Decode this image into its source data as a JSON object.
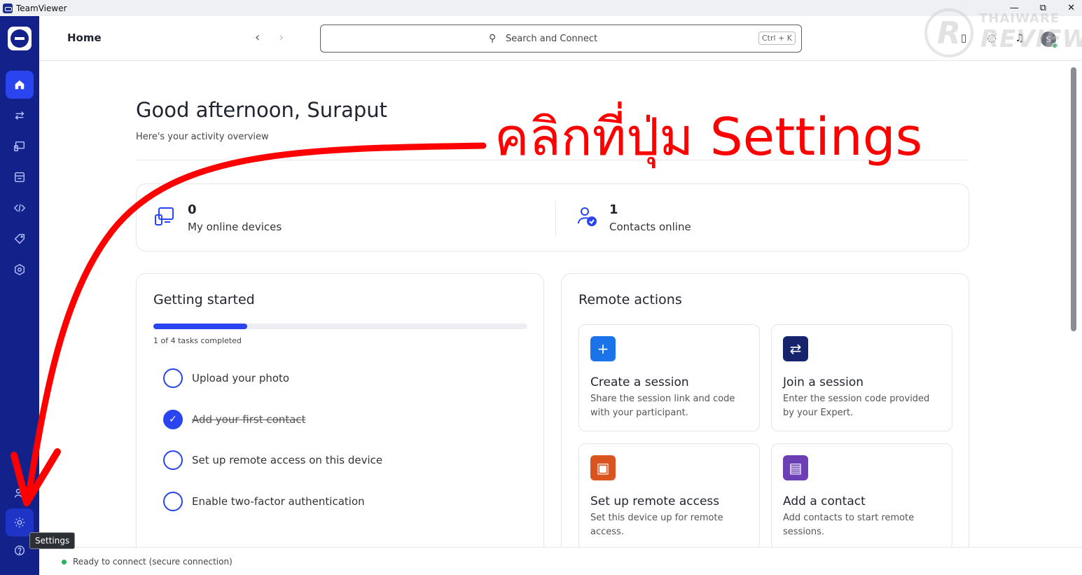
{
  "window": {
    "title": "TeamViewer",
    "controls": {
      "minimize": "—",
      "restore": "⧉",
      "close": "✕"
    }
  },
  "header": {
    "breadcrumb": "Home",
    "search_placeholder": "Search and Connect",
    "search_shortcut": "Ctrl + K",
    "avatar_initial": "S"
  },
  "sidebar": {
    "items": [
      {
        "name": "home-icon",
        "active": true
      },
      {
        "name": "connect-arrows-icon",
        "active": false
      },
      {
        "name": "devices-icon",
        "active": false
      },
      {
        "name": "sessions-icon",
        "active": false
      },
      {
        "name": "code-icon",
        "active": false
      },
      {
        "name": "tag-icon",
        "active": false
      },
      {
        "name": "hexagon-settings-icon",
        "active": false
      },
      {
        "name": "people-icon",
        "active": false
      },
      {
        "name": "gear-icon",
        "active": false
      },
      {
        "name": "help-icon",
        "active": false
      }
    ],
    "tooltip": "Settings"
  },
  "main": {
    "greeting": "Good afternoon, Suraput",
    "subtitle": "Here's your activity overview",
    "stats": [
      {
        "value": "0",
        "label": "My online devices",
        "icon": "devices-icon"
      },
      {
        "value": "1",
        "label": "Contacts online",
        "icon": "contact-check-icon"
      }
    ],
    "getting_started": {
      "title": "Getting started",
      "progress_fraction": 0.25,
      "progress_text": "1 of 4 tasks completed",
      "tasks": [
        {
          "label": "Upload your photo",
          "done": false
        },
        {
          "label": "Add your first contact",
          "done": true
        },
        {
          "label": "Set up remote access on this device",
          "done": false
        },
        {
          "label": "Enable two-factor authentication",
          "done": false
        }
      ]
    },
    "remote_actions": {
      "title": "Remote actions",
      "items": [
        {
          "title": "Create a session",
          "desc": "Share the session link and code with your participant.",
          "icon": "plus-icon",
          "color": "#1a73e8",
          "glyph": "+"
        },
        {
          "title": "Join a session",
          "desc": "Enter the session code provided by your Expert.",
          "icon": "swap-arrows-icon",
          "color": "#16246e",
          "glyph": "⇄"
        },
        {
          "title": "Set up remote access",
          "desc": "Set this device up for remote access.",
          "icon": "monitor-access-icon",
          "color": "#d9541e",
          "glyph": "▣"
        },
        {
          "title": "Add a contact",
          "desc": "Add contacts to start remote sessions.",
          "icon": "contact-book-icon",
          "color": "#6d3fb5",
          "glyph": "▤"
        }
      ]
    }
  },
  "status_bar": {
    "text": "Ready to connect (secure connection)",
    "status_color": "#22b35b"
  },
  "watermark": {
    "line1": "THAIWARE",
    "line2": "REVIEW",
    "badge": "R"
  },
  "annotation": {
    "text": "คลิกที่ปุ่ม Settings",
    "color": "#ff0000"
  }
}
